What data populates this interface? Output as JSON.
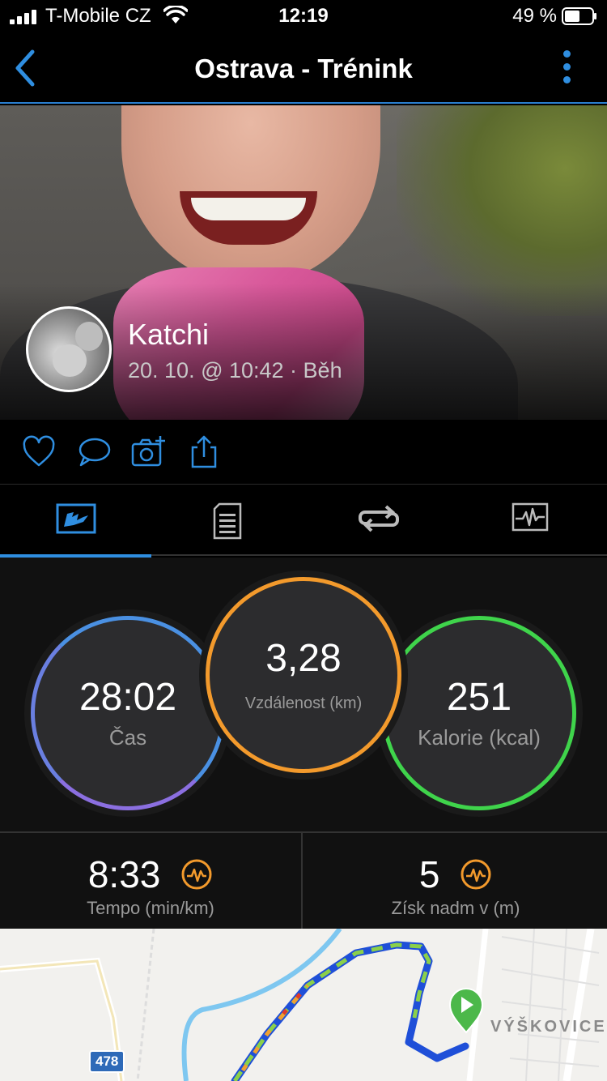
{
  "status_bar": {
    "carrier": "T-Mobile CZ",
    "time": "12:19",
    "battery": "49 %"
  },
  "nav": {
    "title": "Ostrava - Trénink",
    "back_icon": "chevron-left-icon",
    "more_icon": "more-vertical-icon"
  },
  "activity": {
    "user_name": "Katchi",
    "meta": "20. 10. @ 10:42 · Běh"
  },
  "actions": [
    "like-icon",
    "comment-icon",
    "add-photo-icon",
    "share-icon"
  ],
  "tabs": [
    "overview-icon",
    "details-icon",
    "laps-icon",
    "chart-icon"
  ],
  "stats": {
    "time": {
      "value": "28:02",
      "label": "Čas",
      "color": "#4a90e2"
    },
    "distance": {
      "value": "3,28",
      "label": "Vzdálenost (km)",
      "color": "#f39a2c"
    },
    "calories": {
      "value": "251",
      "label": "Kalorie (kcal)",
      "color": "#3fd44b"
    }
  },
  "metrics": {
    "pace": {
      "value": "8:33",
      "label": "Tempo (min/km)"
    },
    "elevation": {
      "value": "5",
      "label": "Získ nadm v (m)"
    }
  },
  "map": {
    "place": "VÝŠKOVICE",
    "road_number": "478"
  },
  "colors": {
    "accent": "#2f8ee0",
    "badge": "#f39a2c"
  }
}
